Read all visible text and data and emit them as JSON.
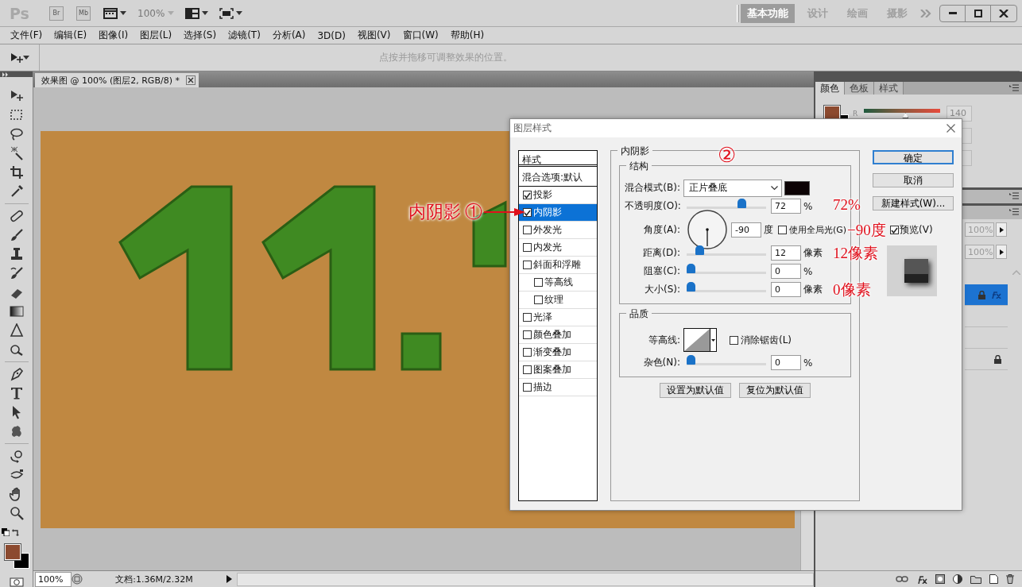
{
  "app_bar": {
    "logo": "Ps",
    "launch_buttons": [
      "Br",
      "Mb"
    ],
    "zoom": "100%",
    "workspaces": [
      {
        "label": "基本功能",
        "selected": true
      },
      {
        "label": "设计",
        "selected": false
      },
      {
        "label": "绘画",
        "selected": false
      },
      {
        "label": "摄影",
        "selected": false
      }
    ]
  },
  "menu": [
    "文件(F)",
    "编辑(E)",
    "图像(I)",
    "图层(L)",
    "选择(S)",
    "滤镜(T)",
    "分析(A)",
    "3D(D)",
    "视图(V)",
    "窗口(W)",
    "帮助(H)"
  ],
  "options_bar": {
    "hint": "点按并拖移可调整效果的位置。"
  },
  "document": {
    "tab_title": "效果图 @ 100% (图层2, RGB/8) *"
  },
  "status_bar": {
    "zoom": "100%",
    "doc_info": "文档:1.36M/2.32M"
  },
  "color_panel": {
    "tabs": [
      {
        "label": "颜色",
        "selected": true
      },
      {
        "label": "色板",
        "selected": false
      },
      {
        "label": "样式",
        "selected": false
      }
    ],
    "channel_label": "R",
    "channel_value": "140",
    "level": 0.55
  },
  "layers_panel": {
    "opacity": "100%",
    "fill": "100%",
    "rows": [
      {
        "selected": true,
        "locked": true,
        "has_effects": true
      },
      {
        "selected": false,
        "locked": false,
        "has_effects": false
      },
      {
        "selected": false,
        "locked": false,
        "has_effects": false
      },
      {
        "selected": false,
        "locked": true,
        "has_effects": false
      }
    ]
  },
  "dialog": {
    "title": "图层样式",
    "list_header": "样式",
    "blend_options": "混合选项:默认",
    "styles": [
      {
        "label": "投影",
        "checked": true,
        "selected": false
      },
      {
        "label": "内阴影",
        "checked": true,
        "selected": true,
        "annotation": "内阴影 ①"
      },
      {
        "label": "外发光",
        "checked": false,
        "selected": false
      },
      {
        "label": "内发光",
        "checked": false,
        "selected": false
      },
      {
        "label": "斜面和浮雕",
        "checked": false,
        "selected": false,
        "children": [
          {
            "label": "等高线",
            "checked": false,
            "selected": false
          },
          {
            "label": "纹理",
            "checked": false,
            "selected": false
          }
        ]
      },
      {
        "label": "光泽",
        "checked": false,
        "selected": false
      },
      {
        "label": "颜色叠加",
        "checked": false,
        "selected": false
      },
      {
        "label": "渐变叠加",
        "checked": false,
        "selected": false
      },
      {
        "label": "图案叠加",
        "checked": false,
        "selected": false
      },
      {
        "label": "描边",
        "checked": false,
        "selected": false
      }
    ],
    "section_title": "内阴影",
    "section_annotation": "②",
    "structure": {
      "title": "结构",
      "blend_mode_label": "混合模式(B):",
      "blend_mode": "正片叠底",
      "rows": [
        {
          "kind": "slider",
          "label": "不透明度(O):",
          "value": "72",
          "unit": "%",
          "level": 0.72,
          "annotation": "72%"
        },
        {
          "kind": "angle",
          "label": "角度(A):",
          "value": "-90",
          "unit": "度",
          "global_light": {
            "label": "使用全局光(G)",
            "checked": false
          },
          "annotation": "−90度"
        },
        {
          "kind": "slider",
          "label": "距离(D):",
          "value": "12",
          "unit": "像素",
          "level": 0.12,
          "annotation": "12像素"
        },
        {
          "kind": "slider",
          "label": "阻塞(C):",
          "value": "0",
          "unit": "%",
          "level": 0
        },
        {
          "kind": "slider",
          "label": "大小(S):",
          "value": "0",
          "unit": "像素",
          "level": 0,
          "annotation": "0像素"
        }
      ]
    },
    "quality": {
      "title": "品质",
      "contour_label": "等高线:",
      "anti_alias": {
        "label": "消除锯齿(L)",
        "checked": false
      },
      "noise": {
        "label": "杂色(N):",
        "value": "0",
        "unit": "%",
        "level": 0
      }
    },
    "reset_buttons": [
      "设置为默认值",
      "复位为默认值"
    ],
    "buttons": [
      {
        "label": "确定",
        "default": true
      },
      {
        "label": "取消",
        "default": false
      },
      {
        "label": "新建样式(W)...",
        "default": false
      }
    ],
    "preview": {
      "label": "预览(V)",
      "checked": true
    }
  }
}
